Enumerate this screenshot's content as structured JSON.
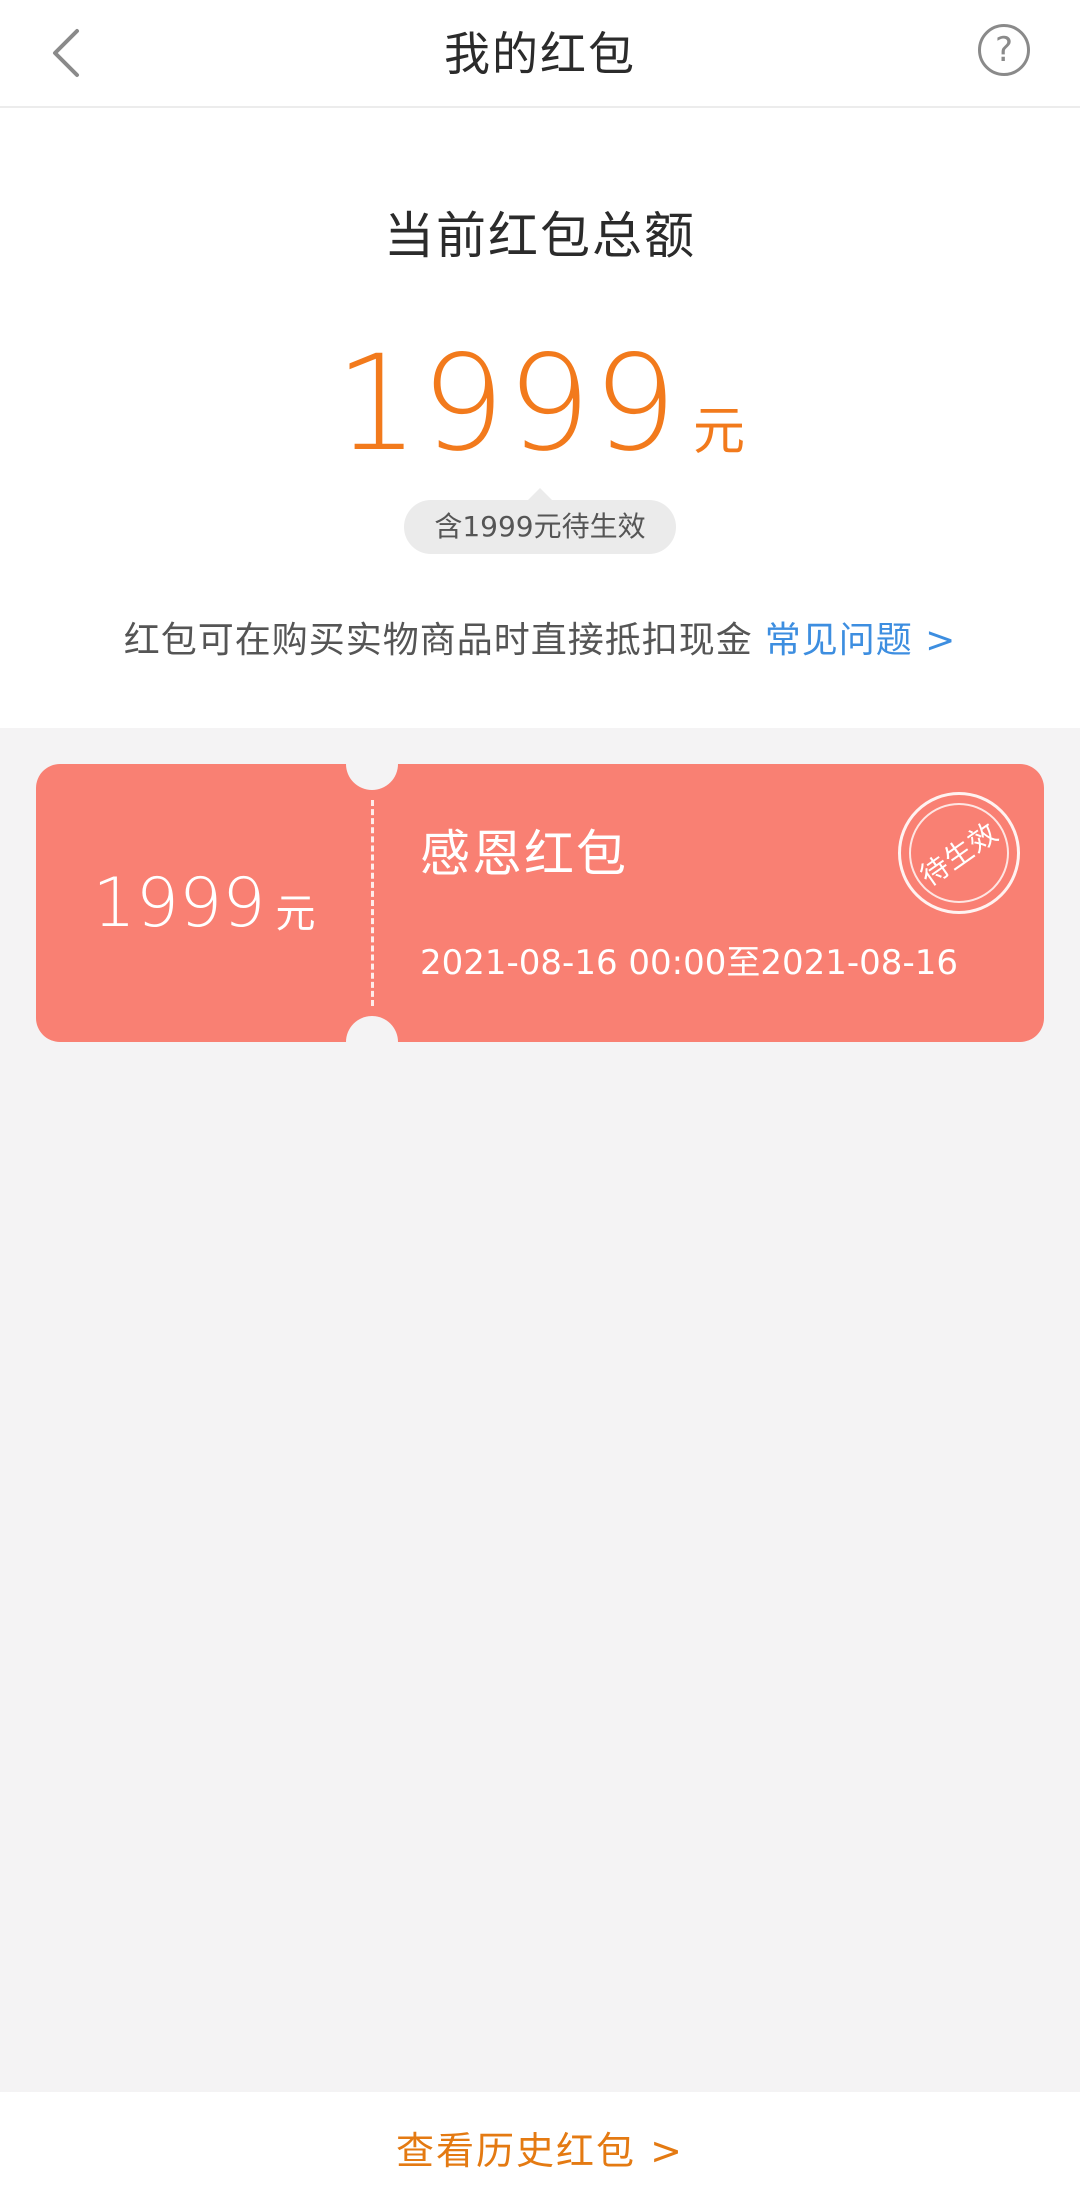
{
  "header": {
    "title": "我的红包",
    "back_icon": "chevron-left-icon",
    "help_icon": "question-circle-icon",
    "help_glyph": "?"
  },
  "summary": {
    "title": "当前红包总额",
    "amount": "1999",
    "unit": "元",
    "pending_note": "含1999元待生效",
    "info_text": "红包可在购买实物商品时直接抵扣现金",
    "faq_link": "常见问题 >"
  },
  "coupons": [
    {
      "amount": "1999",
      "unit": "元",
      "title": "感恩红包",
      "validity": "2021-08-16 00:00至2021-08-16",
      "stamp": "待生效"
    }
  ],
  "footer": {
    "history_link": "查看历史红包 >"
  },
  "colors": {
    "accent_orange": "#f27a1c",
    "coupon_bg": "#f98073",
    "link_blue": "#3d8ee0",
    "footer_link": "#e47a12",
    "page_bg": "#f4f3f4"
  }
}
